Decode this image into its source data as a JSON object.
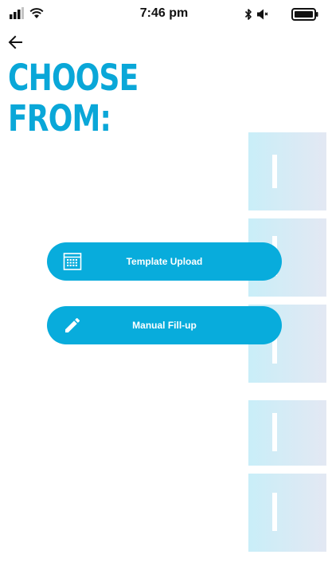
{
  "status_bar": {
    "time": "7:46 pm",
    "icons": [
      "signal-icon",
      "wifi-icon",
      "bluetooth-icon",
      "volume-mute-icon",
      "battery-icon"
    ]
  },
  "header": {
    "back_icon": "arrow-left-icon",
    "title_line1": "CHOOSE",
    "title_line2": "FROM:"
  },
  "options": [
    {
      "label": "Template Upload",
      "icon": "template-grid-icon"
    },
    {
      "label": "Manual Fill-up",
      "icon": "pencil-icon"
    }
  ],
  "colors": {
    "accent": "#0aa7d8",
    "button": "#08acdc",
    "watermark": "#d6eef6",
    "text_dark": "#111111"
  }
}
